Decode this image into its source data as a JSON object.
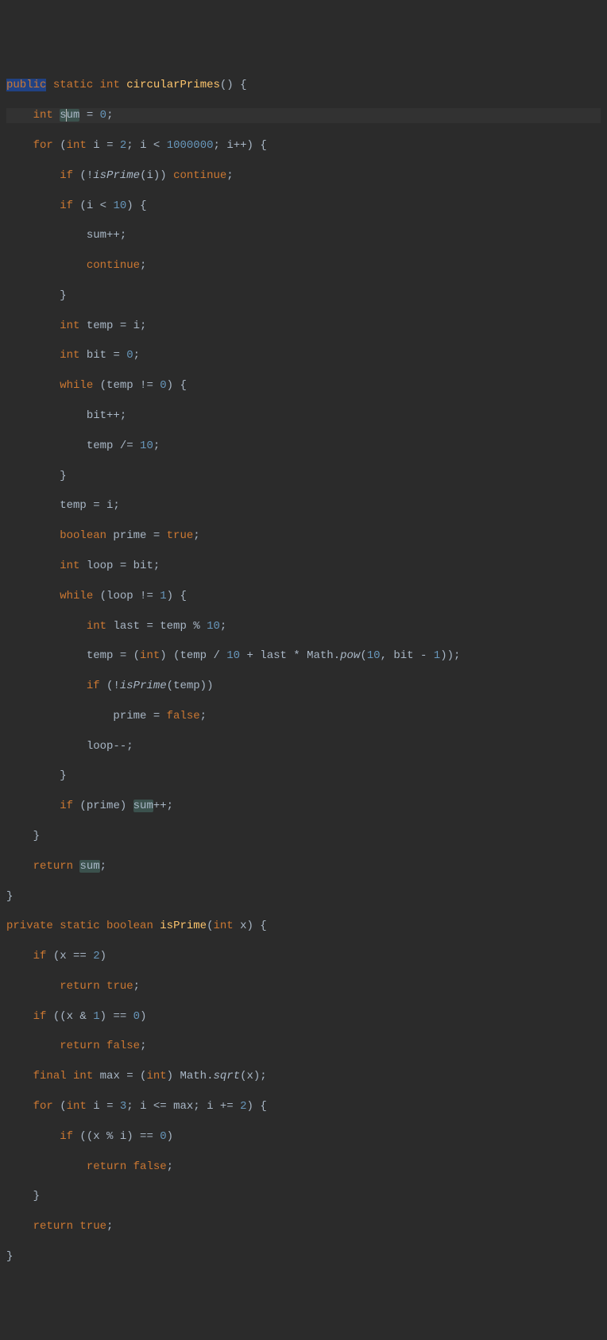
{
  "code": {
    "m1": {
      "public": "public",
      "static": "static",
      "int": "int",
      "name": "circularPrimes",
      "open": "() {"
    },
    "l2": {
      "int": "int",
      "s": "s",
      "um": "um",
      "eq": " = ",
      "zero": "0",
      "semi": ";"
    },
    "l3": {
      "for": "for",
      "open": " (",
      "int": "int",
      "i": " i = ",
      "two": "2",
      "semi1": "; i < ",
      "mill": "1000000",
      "semi2": "; i++) {"
    },
    "l4": {
      "if": "if",
      "open": " (!",
      "is": "isPrime",
      "rest": "(i)) ",
      "cont": "continue",
      "semi": ";"
    },
    "l5": {
      "if": "if",
      "open": " (i < ",
      "ten": "10",
      "close": ") {"
    },
    "l6": {
      "sum": "sum++;"
    },
    "l7": {
      "cont": "continue",
      "semi": ";"
    },
    "l8": {
      "cb": "}"
    },
    "l9": {
      "int": "int",
      "rest": " temp = i;"
    },
    "l10": {
      "int": "int",
      "bit": " bit = ",
      "zero": "0",
      "semi": ";"
    },
    "l11": {
      "while": "while",
      "open": " (temp != ",
      "zero": "0",
      "close": ") {"
    },
    "l12": {
      "txt": "bit++;"
    },
    "l13": {
      "txt": "temp /= ",
      "ten": "10",
      "semi": ";"
    },
    "l14": {
      "cb": "}"
    },
    "l15": {
      "txt": "temp = i;"
    },
    "l16": {
      "bool": "boolean",
      "txt": " prime = ",
      "true": "true",
      "semi": ";"
    },
    "l17": {
      "int": "int",
      "txt": " loop = bit;"
    },
    "l18": {
      "while": "while",
      "open": " (loop != ",
      "one": "1",
      "close": ") {"
    },
    "l19": {
      "int": "int",
      "txt": " last = temp % ",
      "ten": "10",
      "semi": ";"
    },
    "l20": {
      "a": "temp = (",
      "int": "int",
      "b": ") (temp / ",
      "ten": "10",
      "c": " + last * Math.",
      "pow": "pow",
      "d": "(",
      "ten2": "10",
      "e": ", bit - ",
      "one": "1",
      "f": "));"
    },
    "l21": {
      "if": "if",
      "open": " (!",
      "is": "isPrime",
      "rest": "(temp))"
    },
    "l22": {
      "txt": "prime = ",
      "false": "false",
      "semi": ";"
    },
    "l23": {
      "txt": "loop--;"
    },
    "l24": {
      "cb": "}"
    },
    "l25": {
      "if": "if",
      "open": " (prime) ",
      "sum": "sum",
      "rest": "++;"
    },
    "l26": {
      "cb": "}"
    },
    "l27": {
      "ret": "return",
      "sp": " ",
      "sum": "sum",
      "semi": ";"
    },
    "l28": {
      "cb": "}"
    },
    "m2": {
      "private": "private",
      "static": "static",
      "bool": "boolean",
      "name": "isPrime",
      "open": "(",
      "int": "int",
      "rest": " x) {"
    },
    "l30": {
      "if": "if",
      "open": " (x == ",
      "two": "2",
      "close": ")"
    },
    "l31": {
      "ret": "return",
      "true": " true",
      "semi": ";"
    },
    "l32": {
      "if": "if",
      "open": " ((x & ",
      "one": "1",
      "b": ") == ",
      "zero": "0",
      "close": ")"
    },
    "l33": {
      "ret": "return",
      "false": " false",
      "semi": ";"
    },
    "l34": {
      "final": "final",
      "int": " int",
      "txt": " max = (",
      "int2": "int",
      "b": ") Math.",
      "sqrt": "sqrt",
      "rest": "(x);"
    },
    "l35": {
      "for": "for",
      "open": " (",
      "int": "int",
      "a": " i = ",
      "three": "3",
      "b": "; i <= max; i += ",
      "two": "2",
      "close": ") {"
    },
    "l36": {
      "if": "if",
      "open": " ((x % i) == ",
      "zero": "0",
      "close": ")"
    },
    "l37": {
      "ret": "return",
      "false": " false",
      "semi": ";"
    },
    "l38": {
      "cb": "}"
    },
    "l39": {
      "ret": "return",
      "true": " true",
      "semi": ";"
    },
    "l40": {
      "cb": "}"
    }
  }
}
